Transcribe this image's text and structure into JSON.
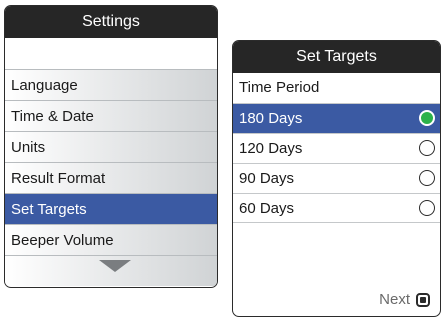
{
  "settings": {
    "title": "Settings",
    "items": [
      {
        "label": "Language"
      },
      {
        "label": "Time & Date"
      },
      {
        "label": "Units"
      },
      {
        "label": "Result Format"
      },
      {
        "label": "Set Targets",
        "selected": true
      },
      {
        "label": "Beeper Volume"
      }
    ],
    "scroll_icon": "chevron-down-icon"
  },
  "targets": {
    "title": "Set Targets",
    "header": "Time Period",
    "options": [
      {
        "label": "180 Days",
        "selected": true
      },
      {
        "label": "120 Days"
      },
      {
        "label": "90 Days"
      },
      {
        "label": "60 Days"
      }
    ],
    "next_label": "Next",
    "next_icon": "square-button-icon"
  },
  "colors": {
    "titlebar": "#262626",
    "selected": "#3b5aa3",
    "radio_on": "#2db24a"
  }
}
